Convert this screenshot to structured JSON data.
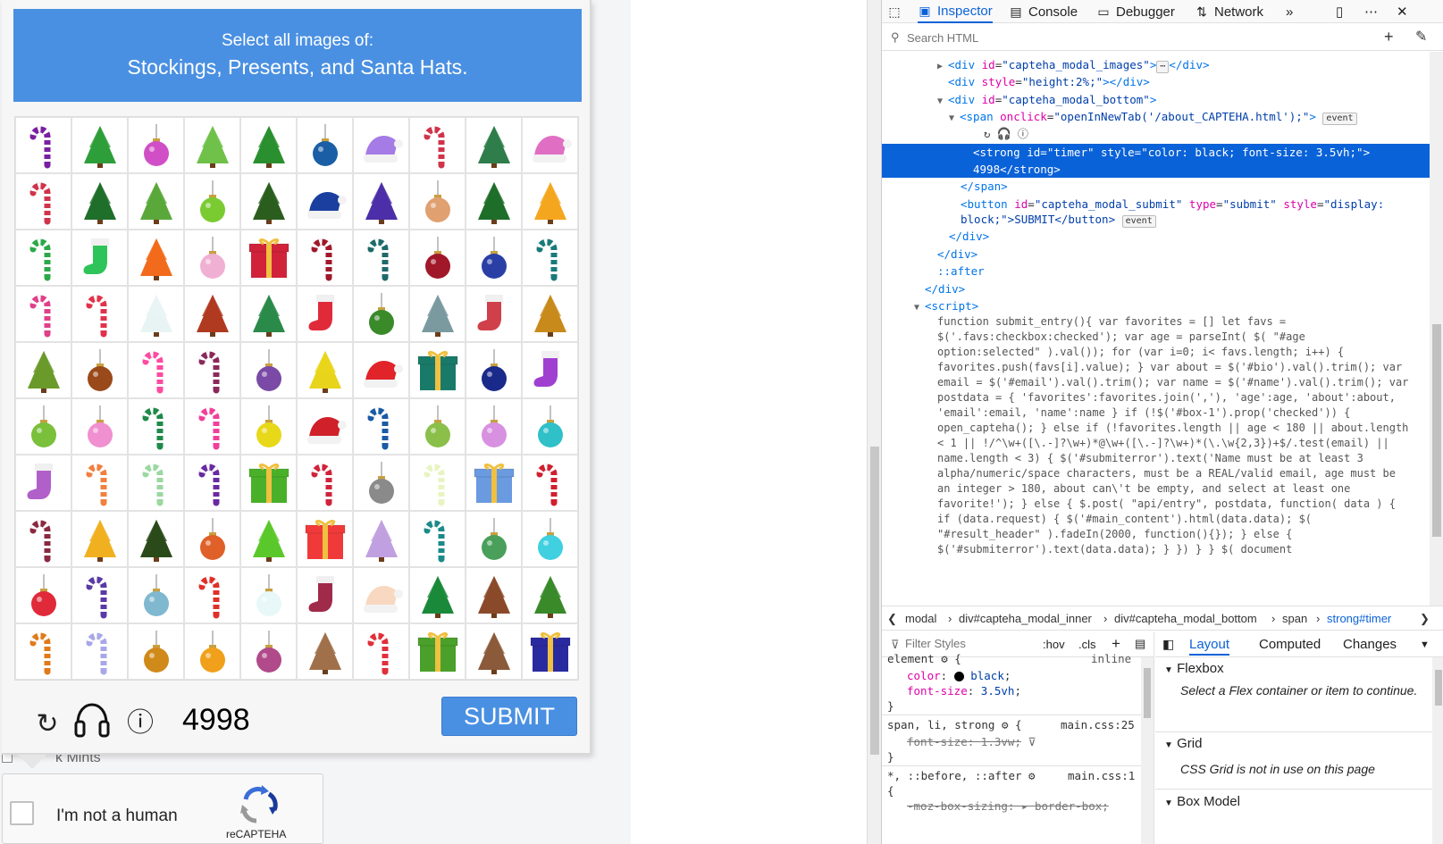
{
  "captcha": {
    "prompt_line1": "Select all images of:",
    "prompt_line2": "Stockings, Presents, and Santa Hats.",
    "timer": "4998",
    "submit_label": "SUBMIT",
    "grid_rows": [
      [
        "candy-cane",
        "tree",
        "ornament",
        "tree",
        "tree",
        "ornament",
        "santa-hat",
        "candy-cane",
        "tree",
        "santa-hat"
      ],
      [
        "candy-cane",
        "tree",
        "tree",
        "ornament",
        "tree",
        "santa-hat",
        "tree",
        "ornament",
        "tree",
        "tree"
      ],
      [
        "candy-cane",
        "stocking",
        "tree",
        "ornament",
        "present",
        "candy-cane",
        "candy-cane",
        "ornament",
        "ornament",
        "candy-cane"
      ],
      [
        "candy-cane",
        "candy-cane",
        "tree",
        "tree",
        "tree",
        "stocking",
        "ornament",
        "tree",
        "stocking",
        "tree"
      ],
      [
        "tree",
        "ornament",
        "candy-cane",
        "candy-cane",
        "ornament",
        "tree",
        "santa-hat",
        "present",
        "ornament",
        "stocking"
      ],
      [
        "ornament",
        "ornament",
        "candy-cane",
        "candy-cane",
        "ornament",
        "santa-hat",
        "candy-cane",
        "ornament",
        "ornament",
        "ornament"
      ],
      [
        "stocking",
        "candy-cane",
        "candy-cane",
        "candy-cane",
        "present",
        "candy-cane",
        "ornament",
        "candy-cane",
        "present",
        "candy-cane"
      ],
      [
        "candy-cane",
        "tree",
        "tree",
        "ornament",
        "tree",
        "present",
        "tree",
        "candy-cane",
        "ornament",
        "ornament"
      ],
      [
        "ornament",
        "candy-cane",
        "ornament",
        "candy-cane",
        "ornament",
        "stocking",
        "santa-hat",
        "tree",
        "tree",
        "tree"
      ],
      [
        "candy-cane",
        "candy-cane",
        "ornament",
        "ornament",
        "ornament",
        "tree",
        "candy-cane",
        "present",
        "tree",
        "present"
      ]
    ],
    "grid_colors": [
      [
        "#7a1fa2",
        "#2e9e3a",
        "#d14fc6",
        "#6fc14a",
        "#2a8f2e",
        "#1a5fa6",
        "#a57be6",
        "#d0334a",
        "#2e7d4a",
        "#e06fc4"
      ],
      [
        "#d0334a",
        "#1f6e2a",
        "#5aa83a",
        "#7acb32",
        "#2b5e1e",
        "#1a3f9e",
        "#4b2ea8",
        "#e0a070",
        "#1e6e2a",
        "#f4a71e"
      ],
      [
        "#2ca84a",
        "#2ec45a",
        "#f26a1b",
        "#f0b0d4",
        "#d0233a",
        "#a0182a",
        "#1e6a6a",
        "#a0182a",
        "#2a3fa6",
        "#1a7a7a"
      ],
      [
        "#e0408a",
        "#e0334a",
        "#e8f4f4",
        "#b03a20",
        "#2a8a4a",
        "#e02a3a",
        "#3a8a2a",
        "#7a9aa0",
        "#d0404a",
        "#c88a1a"
      ],
      [
        "#6a9a2a",
        "#9a4a1a",
        "#ff4aa0",
        "#8a2a5a",
        "#7a4aa6",
        "#e8d41a",
        "#e0242a",
        "#1a7a6a",
        "#1a2a8a",
        "#a040d0"
      ],
      [
        "#7ac03a",
        "#f090d0",
        "#1e8a4a",
        "#f0409a",
        "#e8d81a",
        "#d0202a",
        "#1a5aa6",
        "#8ac04a",
        "#d890e0",
        "#30c0c8"
      ],
      [
        "#b060c8",
        "#f08040",
        "#9ad8a0",
        "#6a2aa0",
        "#4ab02a",
        "#d0233a",
        "#8a8a8a",
        "#e8f4c0",
        "#6a9ae0",
        "#d02030"
      ],
      [
        "#8a2a40",
        "#f0b020",
        "#2a4a1a",
        "#e0602a",
        "#5ac82a",
        "#f03a3a",
        "#c0a0e0",
        "#1a8a8a",
        "#4aa05a",
        "#40d0e0"
      ],
      [
        "#e02a3a",
        "#5a3aa6",
        "#80b8d0",
        "#e0302a",
        "#e8f8f8",
        "#a02a4a",
        "#f8d8c0",
        "#1a8a3a",
        "#8a4a2a",
        "#3a8a2a"
      ],
      [
        "#e07a1a",
        "#a8a8e8",
        "#d08a1a",
        "#f0a01a",
        "#b04a8a",
        "#a0704a",
        "#e0303a",
        "#4aa02a",
        "#8a5a3a",
        "#2a2aa0"
      ]
    ]
  },
  "behind": {
    "partial_text": "k Mints"
  },
  "widget": {
    "label": "I'm not a human",
    "brand": "reCAPTEHA"
  },
  "devtools": {
    "tabs": [
      "Inspector",
      "Console",
      "Debugger",
      "Network"
    ],
    "search_placeholder": "Search HTML",
    "markup": {
      "l1_tag_open": "<div ",
      "l1_attr": "id",
      "l1_val": "\"capteha_modal_images\"",
      "l1_close": "></div>",
      "l2_attr": "style",
      "l2_val": "\"height:2%;\"",
      "l2_close": "></div>",
      "l3_val": "\"capteha_modal_bottom\"",
      "l4_attr": "onclick",
      "l4_val": "\"openInNewTab('/about_CAPTEHA.html');\"",
      "event_badge": "event",
      "l6_a": "<strong ",
      "l6_id": "id",
      "l6_idval": "\"timer\"",
      "l6_style": "style",
      "l6_styleval": "\"color: black; font-size: 3.5vh;\"",
      "l6_text": "4998</strong>",
      "l7": "</span>",
      "l8_tag": "<button ",
      "l8_id": "id",
      "l8_idval": "\"capteha_modal_submit\"",
      "l8_type": "type",
      "l8_typeval": "\"submit\"",
      "l8_style": "style",
      "l8_styleval": "\"display:",
      "l8b": "block;\">SUBMIT</button>",
      "l9": "</div>",
      "l10": "</div>",
      "l11": "::after",
      "l12": "</div>",
      "l13": "<script>",
      "script_body": "function submit_entry(){ var favorites = [] let favs = $('.favs:checkbox:checked'); var age = parseInt( $( \"#age option:selected\" ).val()); for (var i=0; i< favs.length; i++) { favorites.push(favs[i].value); } var about = $('#bio').val().trim(); var email = $('#email').val().trim(); var name = $('#name').val().trim(); var postdata = { 'favorites':favorites.join(','), 'age':age, 'about':about, 'email':email, 'name':name } if (!$('#box-1').prop('checked')) { open_capteha(); } else if (!favorites.length || age < 180 || about.length < 1 || !/^\\w+([\\.-]?\\w+)*@\\w+([\\.-]?\\w+)*(\\.\\w{2,3})+$/.test(email) || name.length < 3) { $('#submiterror').text('Name must be at least 3 alpha/numeric/space characters, must be a REAL/valid email, age must be an integer > 180, about can\\'t be empty, and select at least one favorite!'); } else { $.post( \"api/entry\", postdata, function( data ) { if (data.request) { $('#main_content').html(data.data); $( \"#result_header\" ).fadeIn(2000, function(){}); } else { $('#submiterror').text(data.data); } }) } } $( document"
    },
    "breadcrumbs": [
      "modal",
      "div#capteha_modal_inner",
      "div#capteha_modal_bottom",
      "span",
      "strong#timer"
    ],
    "rules": {
      "filter_placeholder": "Filter Styles",
      "hov": ":hov",
      "cls": ".cls",
      "element_selector": "element",
      "element_display": "inline",
      "color_prop": "color",
      "color_val": "black",
      "fontsize_prop": "font-size",
      "fontsize_val": "3.5vh",
      "rule2_selector": "span, li, strong",
      "rule2_src": "main.css:25",
      "rule2_prop": "font-size",
      "rule2_val": "1.3vw",
      "rule3_selector": "*, ::before, ::after",
      "rule3_src": "main.css:1",
      "rule3_prop": "-moz-box-sizing",
      "rule3_val": "border-box"
    },
    "layout_tabs": [
      "Layout",
      "Computed",
      "Changes"
    ],
    "flexbox_title": "Flexbox",
    "flexbox_body": "Select a Flex container or item to continue.",
    "grid_title": "Grid",
    "grid_body": "CSS Grid is not in use on this page",
    "boxmodel_title": "Box Model"
  }
}
